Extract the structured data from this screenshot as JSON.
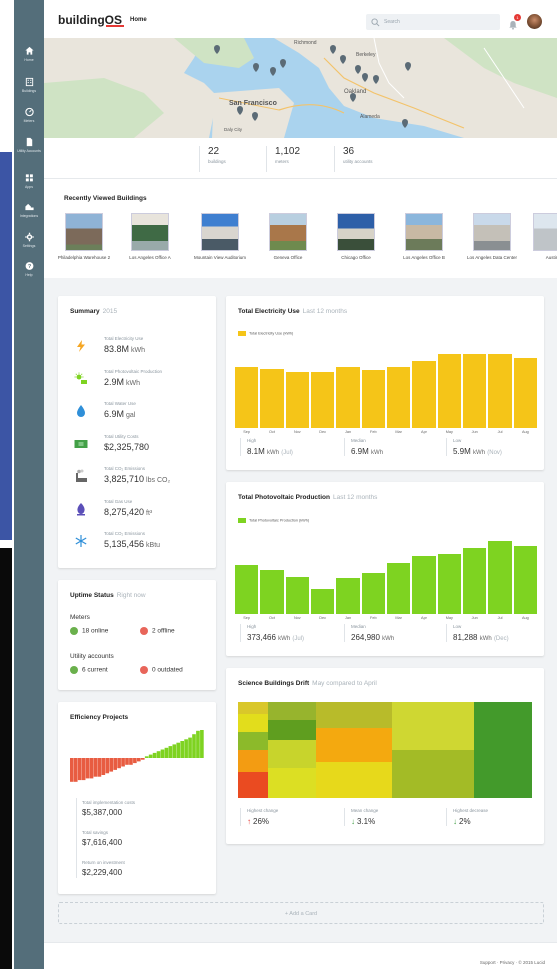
{
  "app": {
    "logo": "buildingOS",
    "nav_home": "Home"
  },
  "search": {
    "placeholder": "Search"
  },
  "notifications": {
    "count": "1"
  },
  "sidebar": {
    "items": [
      {
        "label": "Home",
        "icon": "home-icon"
      },
      {
        "label": "Buildings",
        "icon": "buildings-icon"
      },
      {
        "label": "Meters",
        "icon": "meters-icon"
      },
      {
        "label": "Utility Accounts",
        "icon": "document-icon"
      },
      {
        "label": "Apps",
        "icon": "apps-icon"
      },
      {
        "label": "Integrations",
        "icon": "integrations-icon"
      },
      {
        "label": "Settings",
        "icon": "gear-icon"
      },
      {
        "label": "Help",
        "icon": "help-icon"
      }
    ]
  },
  "map": {
    "labels": [
      "San Francisco",
      "Oakland",
      "Alameda",
      "Berkeley",
      "Richmond",
      "Daly City"
    ]
  },
  "stats": [
    {
      "value": "22",
      "label": "buildings"
    },
    {
      "value": "1,102",
      "label": "meters"
    },
    {
      "value": "36",
      "label": "utility accounts"
    }
  ],
  "recent": {
    "title": "Recently Viewed Buildings",
    "buildings": [
      "Philadelphia Warehouse 2",
      "Los Angeles Office A",
      "Mountain View Auditorium",
      "Geneva Office",
      "Chicago Office",
      "Los Angeles Office B",
      "Los Angeles Data Center",
      "Austin"
    ]
  },
  "summary": {
    "title": "Summary",
    "period": "2015",
    "rows": [
      {
        "label": "Total Electricity Use",
        "value": "83.8M",
        "unit": "kWh",
        "icon": "lightning-icon"
      },
      {
        "label": "Total Photovoltaic Production",
        "value": "2.9M",
        "unit": "kWh",
        "icon": "solar-icon"
      },
      {
        "label": "Total Water Use",
        "value": "6.9M",
        "unit": "gal",
        "icon": "water-drop-icon"
      },
      {
        "label": "Total Utility Costs",
        "value": "$2,325,780",
        "unit": "",
        "icon": "money-icon"
      },
      {
        "label": "Total CO₂ Emissions",
        "value": "3,825,710",
        "unit": "lbs CO₂",
        "icon": "emissions-icon"
      },
      {
        "label": "Total Gas Use",
        "value": "8,275,420",
        "unit": "ft³",
        "icon": "gas-icon"
      },
      {
        "label": "Total CO₂ Emissions",
        "value": "5,135,456",
        "unit": "kBtu",
        "icon": "snowflake-icon"
      }
    ]
  },
  "uptime": {
    "title": "Uptime Status",
    "period": "Right now",
    "meters_label": "Meters",
    "online": "18 online",
    "offline": "2 offline",
    "accounts_label": "Utility accounts",
    "current": "6 current",
    "outdated": "0 outdated"
  },
  "efficiency": {
    "title": "Efficiency Projects",
    "rows": [
      {
        "label": "Total implementation costs",
        "value": "$5,387,000"
      },
      {
        "label": "Total savings",
        "value": "$7,616,400"
      },
      {
        "label": "Return on investment",
        "value": "$2,229,400"
      }
    ],
    "colors": {
      "negative": "#e85c41",
      "positive": "#7ed321"
    }
  },
  "electricity": {
    "title": "Total Electricity Use",
    "period": "Last 12 months",
    "stats": [
      {
        "label": "High",
        "value": "8.1M",
        "unit": "kWh",
        "paren": "(Jul)"
      },
      {
        "label": "Median",
        "value": "6.9M",
        "unit": "kWh",
        "paren": ""
      },
      {
        "label": "Low",
        "value": "5.9M",
        "unit": "kWh",
        "paren": "(Nov)"
      }
    ]
  },
  "photovoltaic": {
    "title": "Total Photovoltaic Production",
    "period": "Last 12 months",
    "stats": [
      {
        "label": "High",
        "value": "373,466",
        "unit": "kWh",
        "paren": "(Jul)"
      },
      {
        "label": "Median",
        "value": "264,980",
        "unit": "kWh",
        "paren": ""
      },
      {
        "label": "Low",
        "value": "81,288",
        "unit": "kWh",
        "paren": "(Dec)"
      }
    ]
  },
  "drift": {
    "title": "Science Buildings Drift",
    "period": "May compared to April",
    "stats": [
      {
        "label": "Highest change",
        "value": "26%",
        "dir": "up"
      },
      {
        "label": "Mean change",
        "value": "3.1%",
        "dir": "down"
      },
      {
        "label": "Highest decrease",
        "value": "2%",
        "dir": "down"
      }
    ]
  },
  "add_card": "+ Add a Card",
  "footer": "Support · Privacy · © 2015 Lucid",
  "chart_data": [
    {
      "type": "bar",
      "categories": [
        "Sep",
        "Oct",
        "Nov",
        "Dec",
        "Jan",
        "Feb",
        "Mar",
        "Apr",
        "May",
        "Jun",
        "Jul",
        "Aug"
      ],
      "series": [
        {
          "name": "Total Electricity Use (kWh)",
          "values": [
            6.7,
            6.4,
            6.1,
            6.1,
            6.6,
            6.3,
            6.6,
            7.3,
            8.1,
            8.1,
            8.1,
            7.6
          ]
        }
      ],
      "color": "#f5c518",
      "ylim": [
        0,
        8.5
      ]
    },
    {
      "type": "bar",
      "categories": [
        "Sep",
        "Oct",
        "Nov",
        "Dec",
        "Jan",
        "Feb",
        "Mar",
        "Apr",
        "May",
        "Jun",
        "Jul",
        "Aug"
      ],
      "series": [
        {
          "name": "Total Photovoltaic Production (kWh)",
          "values": [
            250,
            225,
            190,
            130,
            185,
            210,
            260,
            300,
            310,
            340,
            373,
            350
          ]
        }
      ],
      "color": "#7ed321",
      "ylim": [
        0,
        400
      ]
    }
  ]
}
